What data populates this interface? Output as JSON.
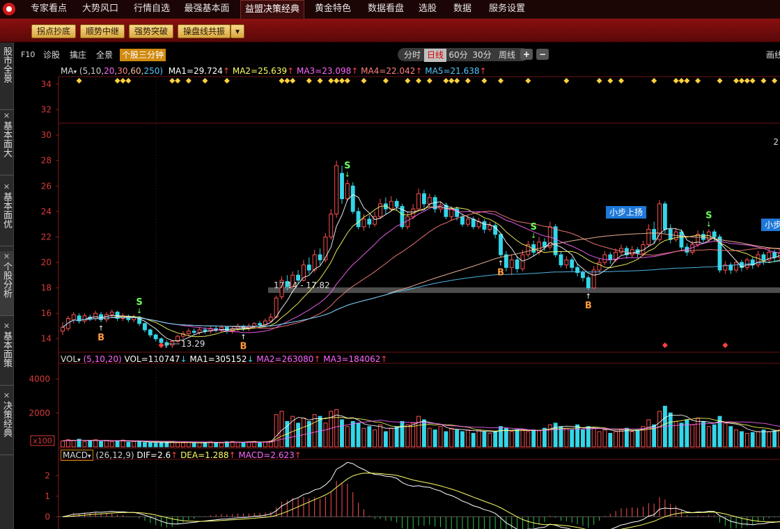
{
  "top_nav": {
    "items": [
      "专家看点",
      "大势风口",
      "行情自选",
      "最强基本面",
      "益盟决策经典",
      "黄金特色",
      "数据看盘",
      "选股",
      "数据",
      "服务设置"
    ],
    "active": "益盟决策经典"
  },
  "sub_toolbar": {
    "buttons": [
      "拐点抄底",
      "顺势中继",
      "强势突破",
      "操盘线共振"
    ]
  },
  "side_tabs": [
    {
      "label": "股市全景",
      "closable": false
    },
    {
      "label": "基本面大",
      "closable": true
    },
    {
      "label": "基本面优",
      "closable": true
    },
    {
      "label": "个股分析",
      "closable": true
    },
    {
      "label": "基本面策",
      "closable": true
    },
    {
      "label": "决策经典",
      "closable": true
    }
  ],
  "chart_toolbar": {
    "f10": "F10",
    "diagnose": "诊股",
    "catch": "擒庄",
    "panorama": "全景",
    "active_tool": "个股三分钟",
    "periods": [
      "分时",
      "日线",
      "60分",
      "30分",
      "周线"
    ],
    "active_period": "日线",
    "zoom_in": "+",
    "zoom_out": "−",
    "right_cut": "画线"
  },
  "ma_legend": {
    "name": "MA",
    "params_prefix": "(5,10,",
    "p20": "20",
    "p30": "30",
    "p60": "60",
    "p250": "250)",
    "ma1": "MA1=29.724",
    "ma2": "MA2=25.639",
    "ma3": "MA3=23.098",
    "ma4": "MA4=22.042",
    "ma5": "MA5=21.638"
  },
  "vol_legend": {
    "name": "VOL",
    "params": "(5,10,20)",
    "vol": "VOL=110747",
    "ma1": "MA1=305152",
    "ma2": "MA2=263080",
    "ma3": "MA3=184062"
  },
  "macd_legend": {
    "name": "MACD",
    "params": "(26,12,9)",
    "dif": "DIF=2.6",
    "dea": "DEA=1.288",
    "macd": "MACD=2.623"
  },
  "annotations": {
    "range_label": "17.14 - 17.82",
    "low_label": "13.29",
    "tag_1": "小步上扬",
    "tag_2": "小步",
    "cut_number": "2",
    "buy": "B",
    "sell": "S",
    "arrow_up": "↑",
    "arrow_down": "↓"
  },
  "colors": {
    "up": "#ff5050",
    "down": "#33d6e8",
    "bg": "#000000",
    "ma5": "#ffffff",
    "ma10": "#ffff66",
    "ma20": "#ff66ff",
    "ma30": "#ff8080",
    "ma60": "#ffc0a0",
    "ma250": "#55c8ff",
    "buy": "#ff9a3c",
    "sell": "#6cff5a"
  },
  "chart_data": {
    "type": "candlestick",
    "price_axis": {
      "ticks": [
        34,
        32,
        30,
        28,
        26,
        24,
        22,
        20,
        18,
        16,
        14
      ],
      "range": [
        13,
        34.6
      ]
    },
    "volume_axis": {
      "ticks": [
        4000,
        2000
      ],
      "unit_label": "x100"
    },
    "macd_axis": {
      "ticks": [
        2,
        1,
        0
      ],
      "range": [
        -0.6,
        2.8
      ]
    },
    "candles": [
      [
        14.6,
        14.9,
        14.3,
        15.3
      ],
      [
        14.8,
        15.6,
        14.6,
        15.8
      ],
      [
        15.5,
        15.9,
        15.2,
        16.1
      ],
      [
        15.8,
        15.4,
        15.2,
        16.0
      ],
      [
        15.4,
        15.8,
        15.2,
        16.0
      ],
      [
        15.7,
        15.6,
        15.4,
        15.9
      ],
      [
        15.6,
        16.0,
        15.4,
        16.2
      ],
      [
        15.9,
        15.5,
        15.3,
        16.1
      ],
      [
        15.5,
        15.9,
        15.3,
        16.1
      ],
      [
        15.9,
        16.1,
        15.7,
        16.3
      ],
      [
        16.1,
        15.6,
        15.4,
        16.2
      ],
      [
        15.6,
        15.8,
        15.4,
        16.0
      ],
      [
        15.7,
        15.5,
        15.3,
        15.9
      ],
      [
        15.5,
        15.7,
        15.3,
        15.9
      ],
      [
        15.7,
        15.2,
        15.0,
        15.8
      ],
      [
        15.2,
        14.7,
        14.5,
        15.3
      ],
      [
        14.7,
        14.3,
        14.1,
        14.8
      ],
      [
        14.3,
        14.0,
        13.8,
        14.4
      ],
      [
        14.0,
        13.7,
        13.5,
        14.1
      ],
      [
        13.7,
        13.5,
        13.3,
        13.9
      ],
      [
        13.5,
        13.8,
        13.29,
        13.9
      ],
      [
        13.8,
        14.2,
        13.7,
        14.3
      ],
      [
        14.2,
        14.4,
        14.0,
        14.6
      ],
      [
        14.4,
        14.6,
        14.2,
        14.8
      ],
      [
        14.6,
        14.5,
        14.3,
        14.8
      ],
      [
        14.5,
        14.7,
        14.3,
        14.9
      ],
      [
        14.7,
        14.6,
        14.4,
        14.9
      ],
      [
        14.6,
        14.8,
        14.4,
        15.0
      ],
      [
        14.8,
        14.7,
        14.5,
        15.0
      ],
      [
        14.7,
        14.9,
        14.5,
        15.1
      ],
      [
        14.9,
        14.6,
        14.4,
        15.0
      ],
      [
        14.6,
        14.8,
        14.4,
        15.0
      ],
      [
        14.8,
        15.0,
        14.6,
        15.2
      ],
      [
        15.0,
        14.8,
        14.6,
        15.1
      ],
      [
        14.8,
        15.0,
        14.6,
        15.2
      ],
      [
        15.0,
        15.2,
        14.8,
        15.3
      ],
      [
        15.2,
        15.1,
        14.9,
        15.4
      ],
      [
        15.1,
        15.4,
        15.0,
        15.6
      ],
      [
        15.4,
        15.7,
        15.3,
        16.0
      ],
      [
        15.7,
        17.2,
        15.6,
        17.4
      ],
      [
        17.3,
        18.6,
        17.1,
        18.9
      ],
      [
        18.5,
        18.1,
        17.8,
        19.0
      ],
      [
        18.1,
        19.0,
        17.9,
        19.3
      ],
      [
        19.0,
        18.6,
        18.3,
        19.4
      ],
      [
        18.6,
        19.8,
        18.5,
        20.2
      ],
      [
        19.8,
        19.4,
        19.1,
        20.4
      ],
      [
        19.4,
        20.6,
        19.2,
        21.0
      ],
      [
        20.6,
        20.2,
        19.8,
        21.1
      ],
      [
        20.2,
        22.0,
        20.0,
        22.3
      ],
      [
        22.0,
        23.8,
        21.8,
        24.2
      ],
      [
        23.8,
        27.6,
        23.5,
        28.0
      ],
      [
        27.0,
        25.0,
        24.6,
        27.6
      ],
      [
        25.0,
        26.2,
        24.8,
        26.5
      ],
      [
        26.0,
        24.0,
        23.8,
        26.3
      ],
      [
        24.0,
        22.8,
        22.6,
        24.3
      ],
      [
        22.8,
        23.4,
        22.5,
        23.8
      ],
      [
        23.4,
        23.0,
        22.7,
        23.7
      ],
      [
        23.0,
        23.6,
        22.8,
        24.0
      ],
      [
        23.6,
        24.6,
        23.4,
        25.0
      ],
      [
        24.6,
        24.2,
        23.8,
        25.1
      ],
      [
        24.2,
        24.8,
        24.0,
        25.2
      ],
      [
        24.8,
        24.4,
        24.1,
        25.0
      ],
      [
        24.4,
        22.8,
        22.6,
        24.6
      ],
      [
        22.8,
        23.6,
        22.6,
        24.0
      ],
      [
        23.6,
        24.2,
        23.4,
        24.6
      ],
      [
        24.2,
        25.4,
        24.0,
        25.8
      ],
      [
        25.4,
        24.6,
        24.3,
        25.7
      ],
      [
        24.6,
        25.1,
        24.4,
        25.4
      ],
      [
        25.1,
        24.2,
        23.9,
        25.3
      ],
      [
        24.2,
        24.5,
        23.9,
        24.8
      ],
      [
        24.5,
        23.6,
        23.4,
        24.7
      ],
      [
        23.6,
        24.2,
        23.3,
        24.4
      ],
      [
        24.2,
        23.6,
        23.3,
        24.4
      ],
      [
        23.6,
        23.0,
        22.8,
        23.8
      ],
      [
        23.0,
        23.4,
        22.8,
        23.7
      ],
      [
        23.4,
        22.8,
        22.6,
        23.6
      ],
      [
        22.8,
        23.2,
        22.6,
        23.5
      ],
      [
        23.2,
        22.6,
        22.3,
        23.4
      ],
      [
        22.6,
        22.9,
        22.4,
        23.2
      ],
      [
        22.9,
        22.2,
        21.9,
        23.1
      ],
      [
        22.2,
        20.6,
        20.4,
        22.3
      ],
      [
        20.6,
        19.6,
        19.3,
        20.9
      ],
      [
        19.6,
        20.2,
        19.0,
        20.6
      ],
      [
        20.2,
        19.5,
        19.2,
        20.5
      ],
      [
        19.5,
        20.6,
        19.3,
        21.0
      ],
      [
        20.6,
        21.4,
        20.4,
        21.7
      ],
      [
        21.4,
        20.8,
        20.5,
        21.7
      ],
      [
        20.8,
        21.6,
        20.6,
        22.0
      ],
      [
        21.6,
        21.2,
        20.9,
        21.9
      ],
      [
        21.2,
        22.8,
        21.0,
        23.2
      ],
      [
        22.8,
        20.6,
        20.4,
        23.0
      ],
      [
        20.6,
        19.8,
        19.6,
        20.9
      ],
      [
        19.8,
        20.2,
        19.5,
        20.5
      ],
      [
        20.2,
        19.6,
        19.3,
        20.4
      ],
      [
        19.6,
        19.2,
        18.9,
        19.9
      ],
      [
        19.2,
        18.8,
        18.5,
        19.4
      ],
      [
        18.8,
        18.0,
        17.82,
        19.0
      ],
      [
        18.0,
        19.4,
        17.9,
        19.7
      ],
      [
        19.4,
        20.0,
        19.2,
        20.3
      ],
      [
        20.0,
        20.6,
        19.8,
        20.9
      ],
      [
        20.6,
        20.2,
        19.9,
        20.8
      ],
      [
        20.2,
        20.8,
        20.0,
        21.1
      ],
      [
        20.8,
        21.1,
        20.6,
        21.4
      ],
      [
        21.1,
        20.6,
        20.3,
        21.3
      ],
      [
        20.6,
        21.0,
        20.4,
        21.3
      ],
      [
        21.0,
        20.7,
        20.4,
        21.2
      ],
      [
        20.7,
        21.4,
        20.5,
        21.7
      ],
      [
        21.4,
        22.6,
        21.2,
        23.0
      ],
      [
        22.6,
        21.8,
        21.5,
        23.2
      ],
      [
        21.8,
        24.6,
        21.6,
        24.9
      ],
      [
        24.6,
        22.6,
        22.3,
        24.8
      ],
      [
        22.6,
        21.8,
        21.5,
        23.0
      ],
      [
        21.8,
        22.4,
        21.6,
        22.7
      ],
      [
        22.4,
        21.2,
        20.9,
        22.6
      ],
      [
        21.2,
        20.8,
        20.5,
        21.5
      ],
      [
        20.8,
        21.4,
        20.6,
        21.7
      ],
      [
        21.4,
        22.2,
        21.2,
        22.5
      ],
      [
        22.2,
        21.8,
        21.5,
        22.5
      ],
      [
        21.8,
        22.4,
        21.6,
        22.6
      ],
      [
        22.4,
        22.0,
        21.7,
        22.6
      ],
      [
        22.0,
        19.4,
        19.2,
        22.2
      ],
      [
        19.4,
        19.8,
        19.1,
        20.1
      ],
      [
        19.8,
        19.4,
        19.1,
        20.0
      ],
      [
        19.4,
        20.0,
        19.2,
        20.2
      ],
      [
        20.0,
        19.6,
        19.3,
        20.2
      ],
      [
        19.6,
        20.2,
        19.4,
        20.4
      ],
      [
        20.2,
        19.8,
        19.5,
        20.4
      ],
      [
        19.8,
        20.6,
        19.6,
        20.9
      ],
      [
        20.6,
        20.2,
        19.8,
        20.8
      ],
      [
        20.2,
        20.8,
        20.0,
        21.1
      ],
      [
        20.8,
        20.4,
        20.0,
        21.0
      ],
      [
        20.4,
        20.7,
        20.2,
        21.0
      ]
    ],
    "volumes": [
      350,
      420,
      380,
      450,
      300,
      360,
      420,
      320,
      380,
      300,
      360,
      400,
      280,
      320,
      300,
      260,
      240,
      220,
      260,
      280,
      300,
      250,
      240,
      260,
      220,
      240,
      280,
      300,
      260,
      240,
      300,
      320,
      280,
      260,
      300,
      320,
      280,
      300,
      340,
      1900,
      2100,
      1500,
      1800,
      1400,
      1700,
      1500,
      1900,
      1800,
      1400,
      2100,
      2200,
      1600,
      1200,
      1500,
      1400,
      1100,
      1200,
      1000,
      1300,
      900,
      1100,
      1200,
      1500,
      1300,
      1400,
      1800,
      1600,
      1100,
      1000,
      1200,
      900,
      1100,
      1000,
      900,
      1000,
      800,
      1000,
      900,
      800,
      900,
      1200,
      1100,
      900,
      1000,
      1000,
      900,
      1000,
      950,
      1100,
      1300,
      1400,
      1200,
      1100,
      1000,
      1300,
      1000,
      1200,
      1100,
      900,
      1000,
      800,
      900,
      1000,
      1100,
      900,
      1000,
      1200,
      1600,
      1300,
      2100,
      2400,
      2000,
      1500,
      1400,
      1600,
      1300,
      1700,
      1500,
      1200,
      1300,
      1800,
      1400,
      1200,
      1000,
      900,
      800,
      850,
      900,
      1000,
      900,
      950,
      1000
    ],
    "buy_signals": [
      7,
      33,
      80,
      96
    ],
    "sell_signals": [
      14,
      52,
      86,
      118
    ],
    "diamond_markers_top": [
      3,
      10,
      11,
      12,
      20,
      21,
      23,
      26,
      30,
      40,
      41,
      42,
      45,
      47,
      49,
      50,
      51,
      52,
      55,
      59,
      63,
      65,
      67,
      70,
      71,
      72,
      74,
      77,
      80,
      85,
      92,
      98,
      100,
      102,
      108,
      112,
      113,
      114,
      116,
      120,
      123,
      124,
      125,
      126,
      128,
      130
    ],
    "diamond_markers_bottom": [
      18,
      110,
      121
    ]
  }
}
